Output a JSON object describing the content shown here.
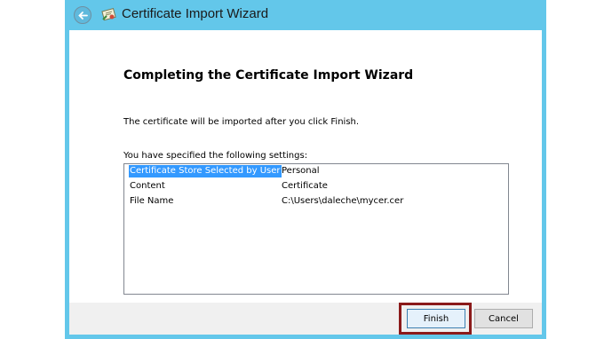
{
  "window": {
    "title": "Certificate Import Wizard"
  },
  "content": {
    "heading": "Completing the Certificate Import Wizard",
    "info_text": "The certificate will be imported after you click Finish.",
    "settings_label": "You have specified the following settings:"
  },
  "settings": [
    {
      "key": "Certificate Store Selected by User",
      "value": "Personal"
    },
    {
      "key": "Content",
      "value": "Certificate"
    },
    {
      "key": "File Name",
      "value": "C:\\Users\\daleche\\mycer.cer"
    }
  ],
  "buttons": {
    "finish": "Finish",
    "cancel": "Cancel"
  },
  "icons": {
    "back": "back-arrow-icon",
    "app": "certificate-icon"
  },
  "colors": {
    "titlebar": "#63c7ea",
    "selection": "#3399ff",
    "highlight_box": "#8b1a1a"
  }
}
